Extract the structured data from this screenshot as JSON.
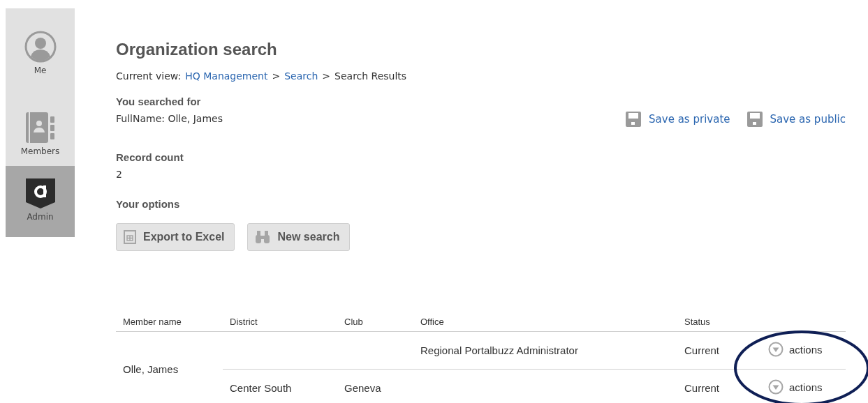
{
  "sidebar": {
    "items": [
      {
        "label": "Me",
        "selected": false
      },
      {
        "label": "Members",
        "selected": false
      },
      {
        "label": "Admin",
        "selected": true
      }
    ]
  },
  "page": {
    "title": "Organization search",
    "breadcrumb": {
      "prefix": "Current view:",
      "links": [
        "HQ Management",
        "Search"
      ],
      "current": "Search Results",
      "separator": ">"
    },
    "searched_for": {
      "label": "You searched for",
      "value": "FullName: Olle, James"
    },
    "save_links": [
      "Save as private",
      "Save as public"
    ],
    "record_count": {
      "label": "Record count",
      "value": "2"
    },
    "options": {
      "label": "Your options",
      "buttons": [
        "Export to Excel",
        "New search"
      ]
    }
  },
  "table": {
    "columns": [
      "Member name",
      "District",
      "Club",
      "Office",
      "Status"
    ],
    "member": "Olle, James",
    "rows": [
      {
        "district": "",
        "club": "",
        "office": "Regional Portalbuzz Administrator",
        "status": "Current",
        "action": "actions"
      },
      {
        "district": "Center South",
        "club": "Geneva",
        "office": "",
        "status": "Current",
        "action": "actions"
      }
    ]
  },
  "annotation": {
    "kind": "ellipse"
  }
}
